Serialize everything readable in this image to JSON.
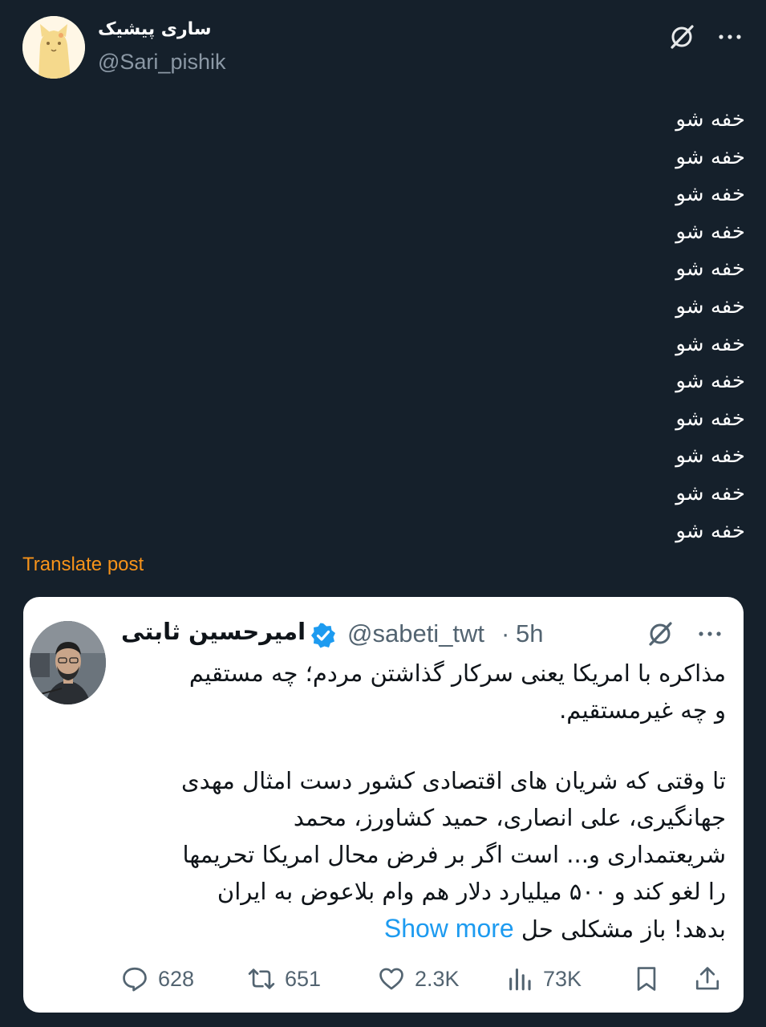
{
  "author": {
    "name": "ساری پیشیک",
    "handle": "@Sari_pishik",
    "avatar_icon": "cat-avatar"
  },
  "post": {
    "lines": [
      "خفه شو",
      "خفه شو",
      "خفه شو",
      "خفه شو",
      "خفه شو",
      "خفه شو",
      "خفه شو",
      "خفه شو",
      "خفه شو",
      "خفه شو",
      "خفه شو",
      "خفه شو"
    ]
  },
  "translate_label": "Translate post",
  "quote": {
    "name": "امیرحسین ثابتی",
    "handle": "@sabeti_twt",
    "separator": "·",
    "time": "5h",
    "paragraph1": [
      "مذاکره با امریکا یعنی سرکار گذاشتن مردم؛ چه مستقیم",
      "و چه غیرمستقیم."
    ],
    "paragraph2": [
      "تا وقتی که شریان های اقتصادی کشور دست امثال مهدی",
      "جهانگیری، علی انصاری، حمید کشاورز، محمد",
      "شریعتمداری و... است اگر بر فرض محال امریکا تحریمها",
      "را لغو کند و ۵۰۰ میلیارد دلار هم وام بلاعوض به ایران"
    ],
    "last_line": "بدهد! باز مشکلی حل",
    "show_more": "Show more"
  },
  "actions": {
    "replies": "628",
    "reposts": "651",
    "likes": "2.3K",
    "views": "73K"
  },
  "colors": {
    "background": "#15202b",
    "accent": "#1d9bf0",
    "translate": "#f7931a",
    "verified": "#1d9bf0"
  }
}
